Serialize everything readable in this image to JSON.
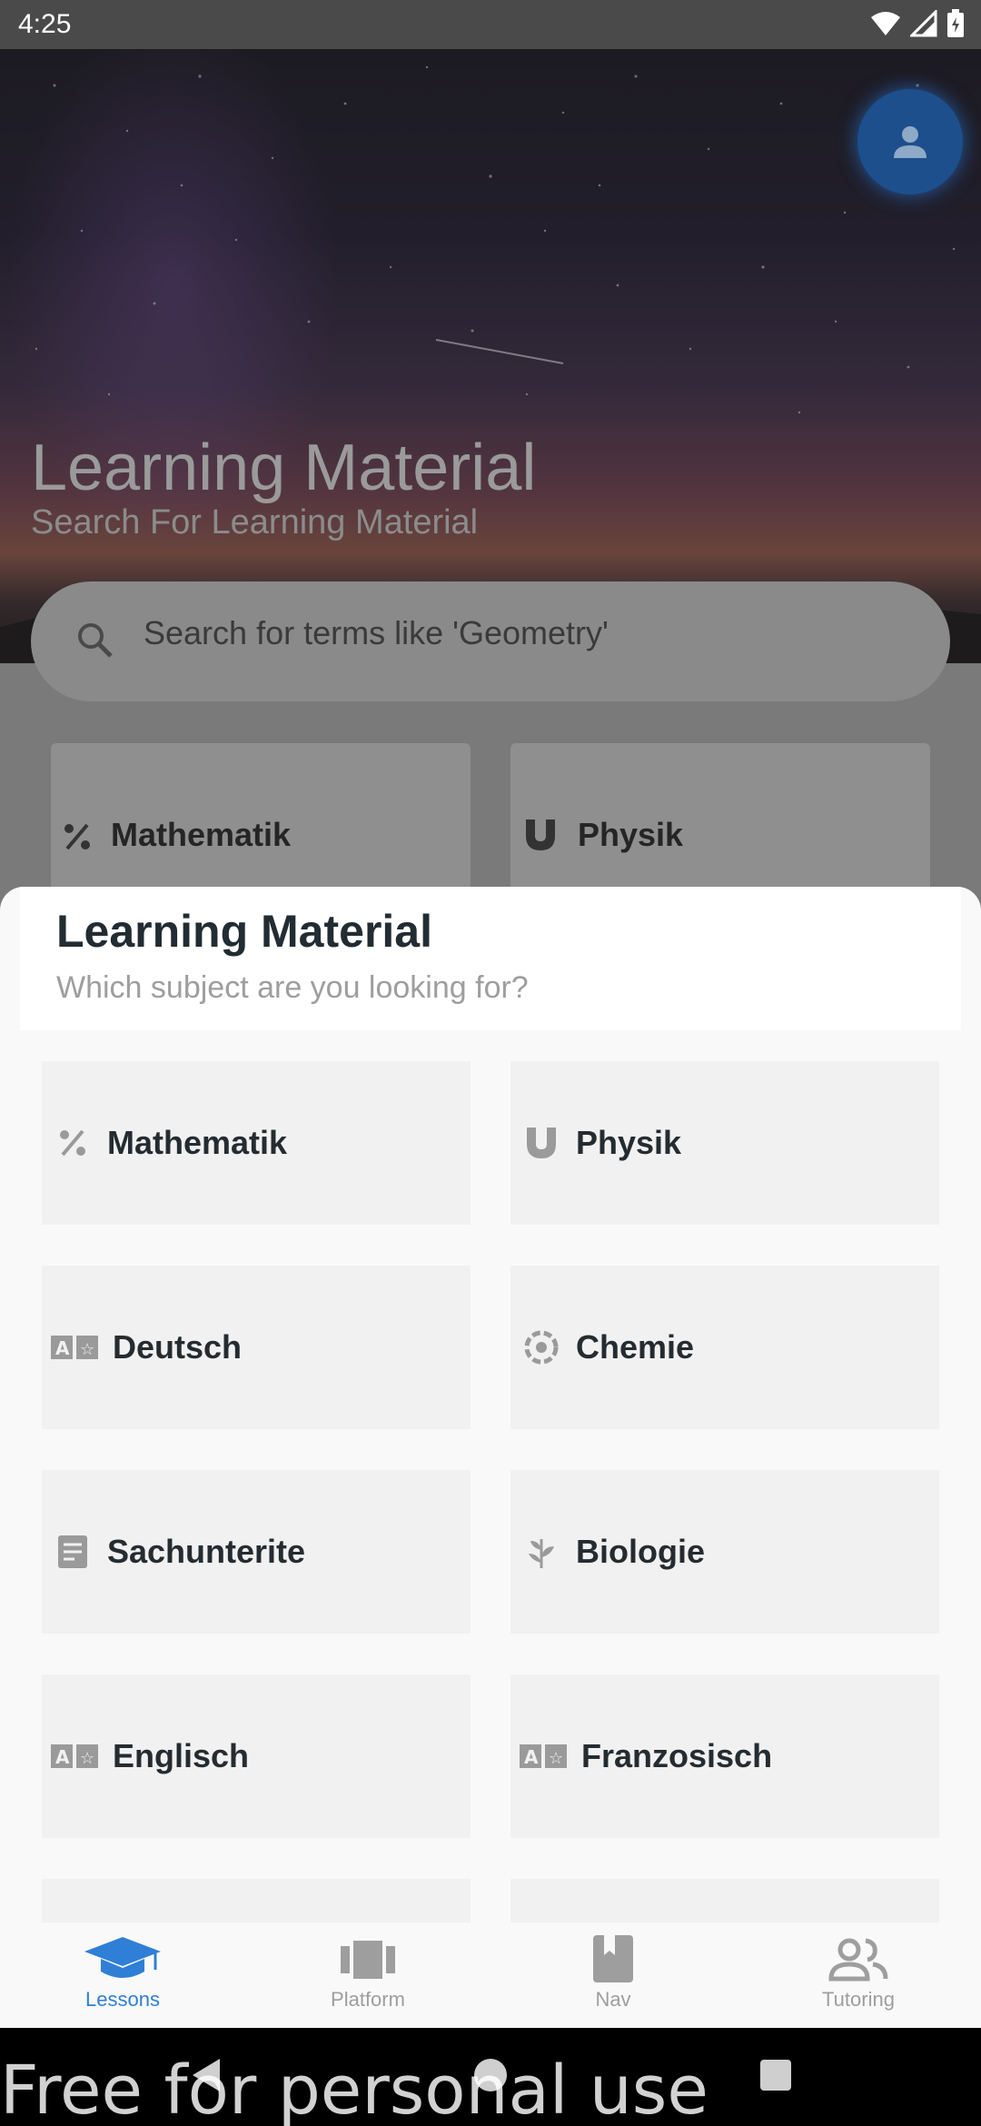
{
  "status_bar": {
    "time": "4:25",
    "icons": [
      "wifi-icon",
      "signal-icon",
      "battery-icon"
    ]
  },
  "hero": {
    "title": "Learning Material",
    "subtitle": "Search For Learning Material"
  },
  "search": {
    "placeholder": "Search for terms like 'Geometry'"
  },
  "background_cards": [
    {
      "label": "Mathematik",
      "icon": "percent-icon"
    },
    {
      "label": "Physik",
      "icon": "magnet-icon"
    }
  ],
  "sheet": {
    "title": "Learning Material",
    "subtitle": "Which subject are you looking for?",
    "subjects": [
      {
        "label": "Mathematik",
        "icon": "percent-icon"
      },
      {
        "label": "Physik",
        "icon": "magnet-icon"
      },
      {
        "label": "Deutsch",
        "icon": "translate-icon"
      },
      {
        "label": "Chemie",
        "icon": "atom-icon"
      },
      {
        "label": "Sachunterite",
        "icon": "book-icon"
      },
      {
        "label": "Biologie",
        "icon": "leaf-icon"
      },
      {
        "label": "Englisch",
        "icon": "translate-icon"
      },
      {
        "label": "Franzosisch",
        "icon": "translate-icon"
      }
    ]
  },
  "bottom_nav": {
    "items": [
      {
        "label": "Lessons",
        "icon": "graduation-cap-icon",
        "active": true
      },
      {
        "label": "Platform",
        "icon": "carousel-icon",
        "active": false
      },
      {
        "label": "Nav",
        "icon": "bookmark-book-icon",
        "active": false
      },
      {
        "label": "Tutoring",
        "icon": "people-icon",
        "active": false
      }
    ]
  },
  "watermark": "Free for personal use",
  "colors": {
    "accent": "#2f7fd6",
    "avatar": "#1d4f8c",
    "text_dark": "#252c31"
  }
}
